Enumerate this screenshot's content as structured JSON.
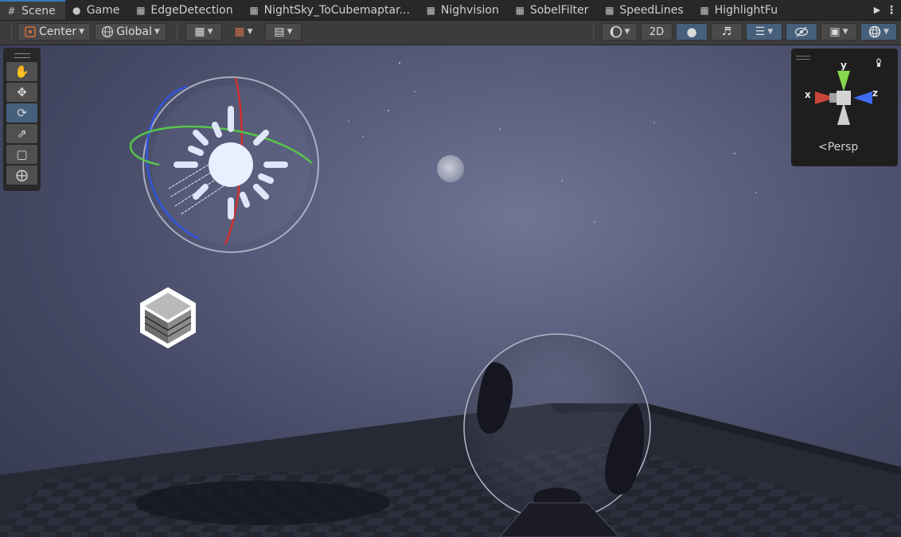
{
  "tabs": [
    {
      "label": "Scene",
      "icon": "grid-icon",
      "active": true
    },
    {
      "label": "Game",
      "icon": "gamepad-icon",
      "active": false
    },
    {
      "label": "EdgeDetection",
      "icon": "shader-graph-icon",
      "active": false
    },
    {
      "label": "NightSky_ToCubemaptar...",
      "icon": "shader-graph-icon",
      "active": false
    },
    {
      "label": "Nighvision",
      "icon": "shader-graph-icon",
      "active": false
    },
    {
      "label": "SobelFilter",
      "icon": "shader-graph-icon",
      "active": false
    },
    {
      "label": "SpeedLines",
      "icon": "shader-graph-icon",
      "active": false
    },
    {
      "label": "HighlightFu",
      "icon": "shader-graph-icon",
      "active": false
    }
  ],
  "toolbar": {
    "pivot_label": "Center",
    "space_label": "Global",
    "mode_2d_label": "2D"
  },
  "tools": [
    "hand-tool",
    "move-tool",
    "rotate-tool",
    "scale-tool",
    "rect-tool",
    "transform-tool"
  ],
  "active_tool": "rotate-tool",
  "gizmo": {
    "projection_label": "Persp",
    "x_label": "x",
    "y_label": "y",
    "z_label": "z"
  },
  "colors": {
    "accent": "#3a79bb",
    "active_button": "#46607c",
    "x_axis": "#c9453a",
    "y_axis": "#86d64a",
    "z_axis": "#3f6bf0"
  }
}
